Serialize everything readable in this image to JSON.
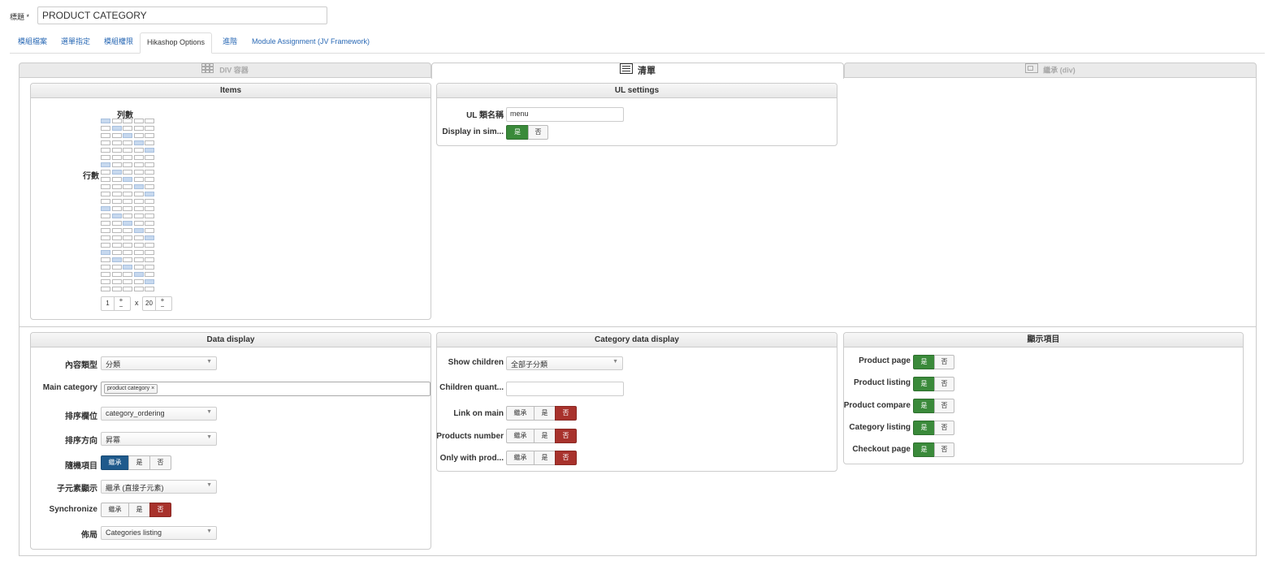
{
  "title": {
    "label": "標題 *",
    "value": "PRODUCT CATEGORY"
  },
  "tabs": [
    {
      "label": "模組檔案"
    },
    {
      "label": "選單指定"
    },
    {
      "label": "模組權限"
    },
    {
      "label": "Hikashop Options"
    },
    {
      "label": "進階"
    },
    {
      "label": "Module Assignment (JV Framework)"
    }
  ],
  "layout_tabs": [
    {
      "label": "DIV 容器",
      "icon": "grid-icon"
    },
    {
      "label": "清單",
      "icon": "list-icon"
    },
    {
      "label": "繼承 (div)",
      "icon": "inherit-icon"
    }
  ],
  "items_panel": {
    "title": "Items",
    "columns_label": "列數",
    "rows_label": "行數",
    "columns_value": "1",
    "rows_value": "20",
    "times": "x",
    "plus": "+",
    "minus": "−"
  },
  "ul_settings": {
    "title": "UL settings",
    "class_label": "UL 類名稱",
    "class_value": "menu",
    "simple_label": "Display in sim...",
    "yes": "是",
    "no": "否"
  },
  "data_display": {
    "title": "Data display",
    "content_type_label": "內容類型",
    "content_type_value": "分類",
    "main_category_label": "Main category",
    "main_category_tag": "product category",
    "ordering_field_label": "排序欄位",
    "ordering_field_value": "category_ordering",
    "ordering_dir_label": "排序方向",
    "ordering_dir_value": "昇冪",
    "random_label": "隨機項目",
    "child_display_label": "子元素顯示",
    "child_display_value": "繼承 (直接子元素)",
    "synchronize_label": "Synchronize",
    "layout_label": "佈局",
    "layout_value": "Categories listing",
    "inherit": "繼承",
    "yes": "是",
    "no": "否"
  },
  "category_data": {
    "title": "Category data display",
    "show_children_label": "Show children",
    "show_children_value": "全部子分類",
    "children_qty_label": "Children quant...",
    "link_main_label": "Link on main",
    "products_number_label": "Products number",
    "only_with_label": "Only with prod...",
    "inherit": "繼承",
    "yes": "是",
    "no": "否"
  },
  "display_panel": {
    "title": "顯示項目",
    "items": [
      {
        "label": "Product page"
      },
      {
        "label": "Product listing"
      },
      {
        "label": "Product compare"
      },
      {
        "label": "Category listing"
      },
      {
        "label": "Checkout page"
      }
    ],
    "yes": "是",
    "no": "否"
  },
  "colors": {
    "link": "#2a69b5",
    "green": "#3a8a3a",
    "red": "#a8322c",
    "blue": "#1f5a8c",
    "grid_highlight": "#c7d9ef"
  }
}
